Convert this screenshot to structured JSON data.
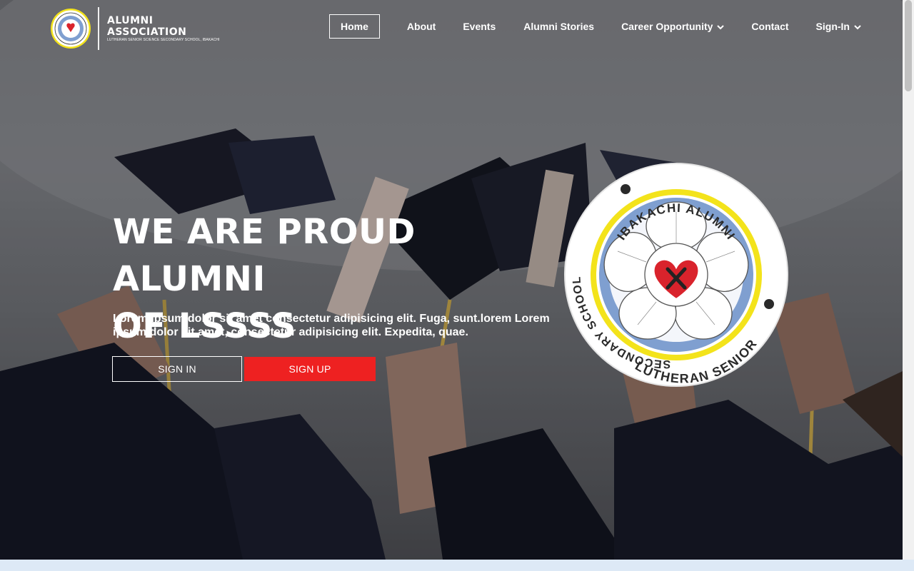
{
  "brand": {
    "line1": "ALUMNI",
    "line2": "ASSOCIATION",
    "line3": "LUTHERAN SENIOR SCIENCE SECONDARY SCHOOL, IBAKACHI"
  },
  "nav": {
    "items": [
      {
        "label": "Home",
        "active": true,
        "dropdown": false
      },
      {
        "label": "About",
        "active": false,
        "dropdown": false
      },
      {
        "label": "Events",
        "active": false,
        "dropdown": false
      },
      {
        "label": "Alumni Stories",
        "active": false,
        "dropdown": false
      },
      {
        "label": "Career Opportunity",
        "active": false,
        "dropdown": true
      },
      {
        "label": "Contact",
        "active": false,
        "dropdown": false
      },
      {
        "label": "Sign-In",
        "active": false,
        "dropdown": true
      }
    ]
  },
  "hero": {
    "headline_line1": "WE ARE PROUD ALUMNI",
    "headline_line2": "OF LSSSS",
    "subtext": "Lorem ipsum dolor sit amet consectetur adipisicing elit. Fuga, sunt.lorem Lorem ipsum dolor sit amet, consectetur adipisicing elit. Expedita, quae.",
    "signin_label": "SIGN IN",
    "signup_label": "SIGN UP"
  },
  "seal": {
    "top_text": "IBAKACHI ALUMNI",
    "left_text": "SECONDARY SCHOOL",
    "bottom_text": "LUTHERAN SENIOR"
  },
  "colors": {
    "accent_red": "#ee2121",
    "seal_yellow": "#f3e31b",
    "seal_blue": "#7f9fd0"
  }
}
